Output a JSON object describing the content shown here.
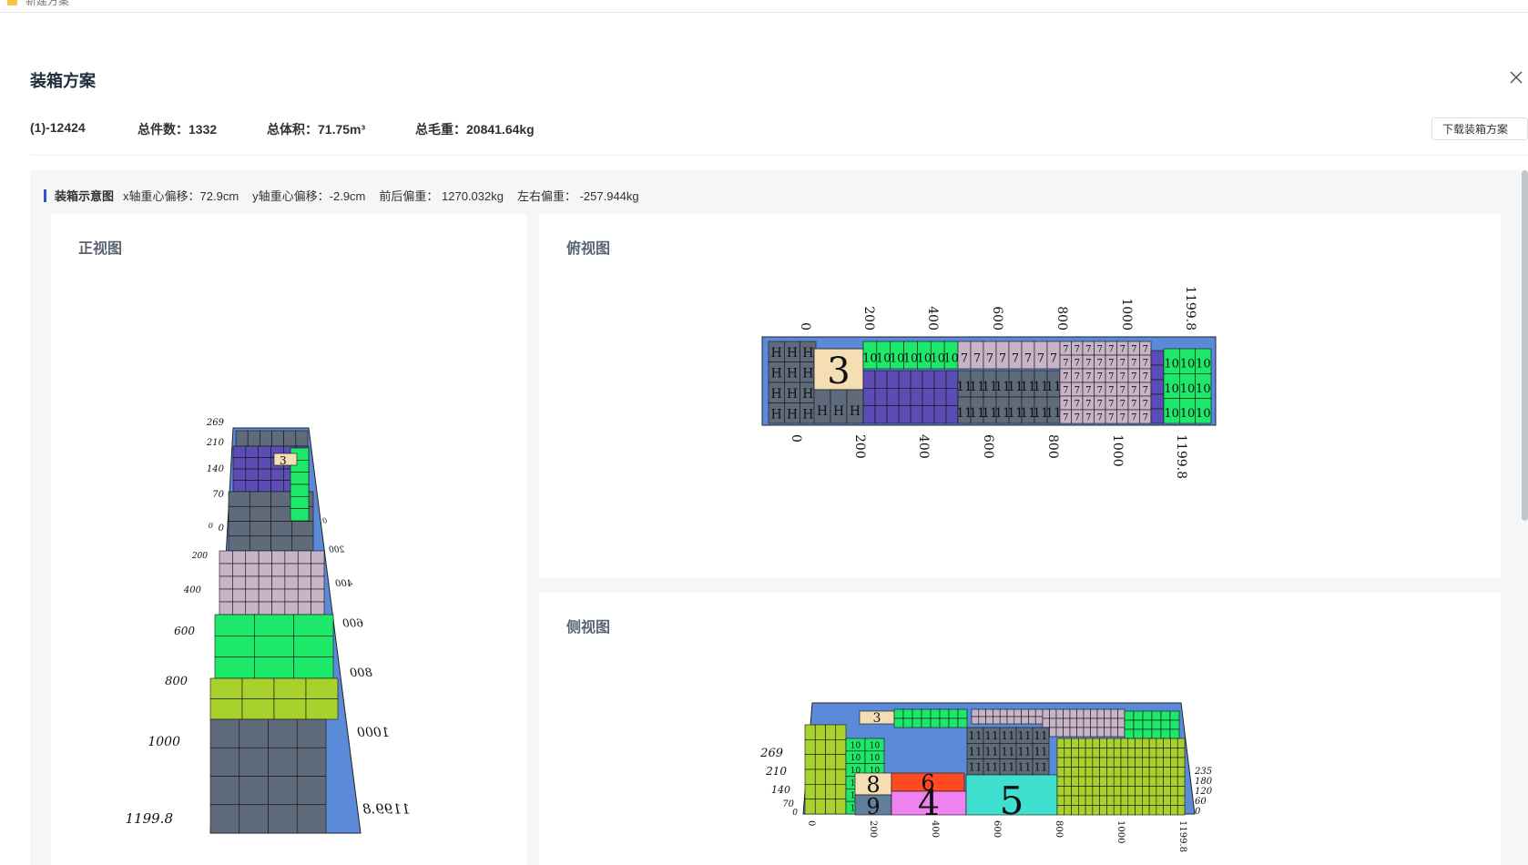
{
  "topbar": {
    "tab_text": "新建方案"
  },
  "modal": {
    "title": "装箱方案",
    "download_label": "下载装箱方案"
  },
  "summary": {
    "id": "(1)-12424",
    "count_label": "总件数：",
    "count": "1332",
    "volume_label": "总体积：",
    "volume": "71.75m³",
    "weight_label": "总毛重：",
    "weight": "20841.64kg"
  },
  "diagram": {
    "title": "装箱示意图",
    "x_offset": "x轴重心偏移：72.9cm",
    "y_offset": "y轴重心偏移：-2.9cm",
    "front_back": "前后偏重：  1270.032kg",
    "left_right": "左右偏重：  -257.944kg"
  },
  "views": {
    "front": {
      "title": "正视图",
      "length_ticks": [
        "0",
        "200",
        "400",
        "600",
        "800",
        "1000",
        "1199.8"
      ],
      "height_ticks": [
        "269",
        "210",
        "140",
        "70",
        "0"
      ]
    },
    "top": {
      "title": "俯视图",
      "length_ticks": [
        "0",
        "200",
        "400",
        "600",
        "800",
        "1000",
        "1199.8"
      ],
      "box_labels": {
        "big3": "3",
        "h": "H",
        "ten": "10",
        "seven": "7",
        "eleven": "11"
      }
    },
    "side": {
      "title": "侧视图",
      "length_ticks": [
        "0",
        "200",
        "400",
        "600",
        "800",
        "1000",
        "1199.8"
      ],
      "height_ticks": [
        "269",
        "210",
        "140",
        "70",
        "0"
      ],
      "depth_ticks": [
        "235",
        "180",
        "120",
        "60",
        "0"
      ],
      "box_labels": {
        "n3": "3",
        "n4": "4",
        "n5": "5",
        "n6": "6",
        "n8": "8",
        "n9": "9",
        "ten": "10",
        "eleven": "11"
      }
    }
  },
  "colors": {
    "container": "#5b8ad8",
    "green": "#1ee86a",
    "lime": "#a9d12e",
    "slate": "#5f6b7a",
    "purple": "#5b4db4",
    "pink": "#c8b4c8",
    "tan": "#f5deb3",
    "magenta": "#ee82ee",
    "cyan": "#40e0d0",
    "orange": "#ff4a22",
    "steel": "#5f7f9a"
  }
}
